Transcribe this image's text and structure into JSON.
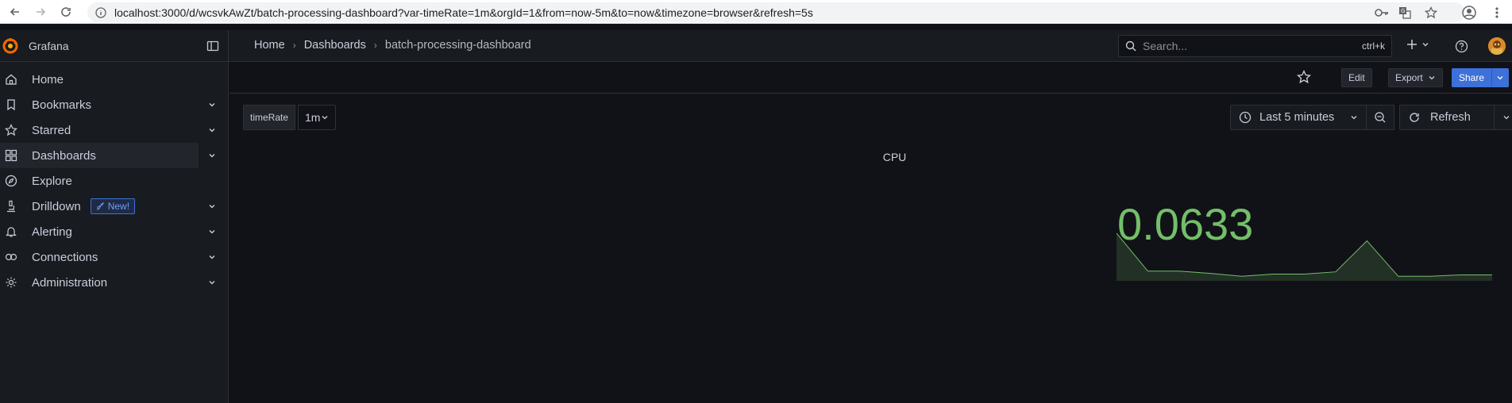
{
  "browser": {
    "url": "localhost:3000/d/wcsvkAwZt/batch-processing-dashboard?var-timeRate=1m&orgId=1&from=now-5m&to=now&timezone=browser&refresh=5s"
  },
  "topbar": {
    "brand": "Grafana",
    "breadcrumbs": [
      "Home",
      "Dashboards",
      "batch-processing-dashboard"
    ],
    "search_placeholder": "Search...",
    "search_shortcut": "ctrl+k"
  },
  "sidebar": {
    "items": [
      {
        "label": "Home",
        "icon": "home-icon",
        "expandable": false
      },
      {
        "label": "Bookmarks",
        "icon": "bookmark-icon",
        "expandable": true
      },
      {
        "label": "Starred",
        "icon": "star-icon",
        "expandable": true
      },
      {
        "label": "Dashboards",
        "icon": "dashboards-icon",
        "expandable": true,
        "active": true
      },
      {
        "label": "Explore",
        "icon": "compass-icon",
        "expandable": false
      },
      {
        "label": "Drilldown",
        "icon": "microscope-icon",
        "expandable": true,
        "badge": "New!"
      },
      {
        "label": "Alerting",
        "icon": "bell-icon",
        "expandable": true
      },
      {
        "label": "Connections",
        "icon": "connections-icon",
        "expandable": true
      },
      {
        "label": "Administration",
        "icon": "gear-icon",
        "expandable": true
      }
    ]
  },
  "toolbar": {
    "edit_label": "Edit",
    "export_label": "Export",
    "share_label": "Share"
  },
  "controls": {
    "variable_label": "timeRate",
    "variable_value": "1m",
    "time_range": "Last 5 minutes",
    "refresh_label": "Refresh"
  },
  "panel": {
    "title": "CPU",
    "value": "0.0633",
    "color": "#73bf69",
    "sparkline": [
      0.0633,
      0.012,
      0.012,
      0.009,
      0.005,
      0.008,
      0.008,
      0.011,
      0.053,
      0.005,
      0.005,
      0.007,
      0.007
    ]
  }
}
